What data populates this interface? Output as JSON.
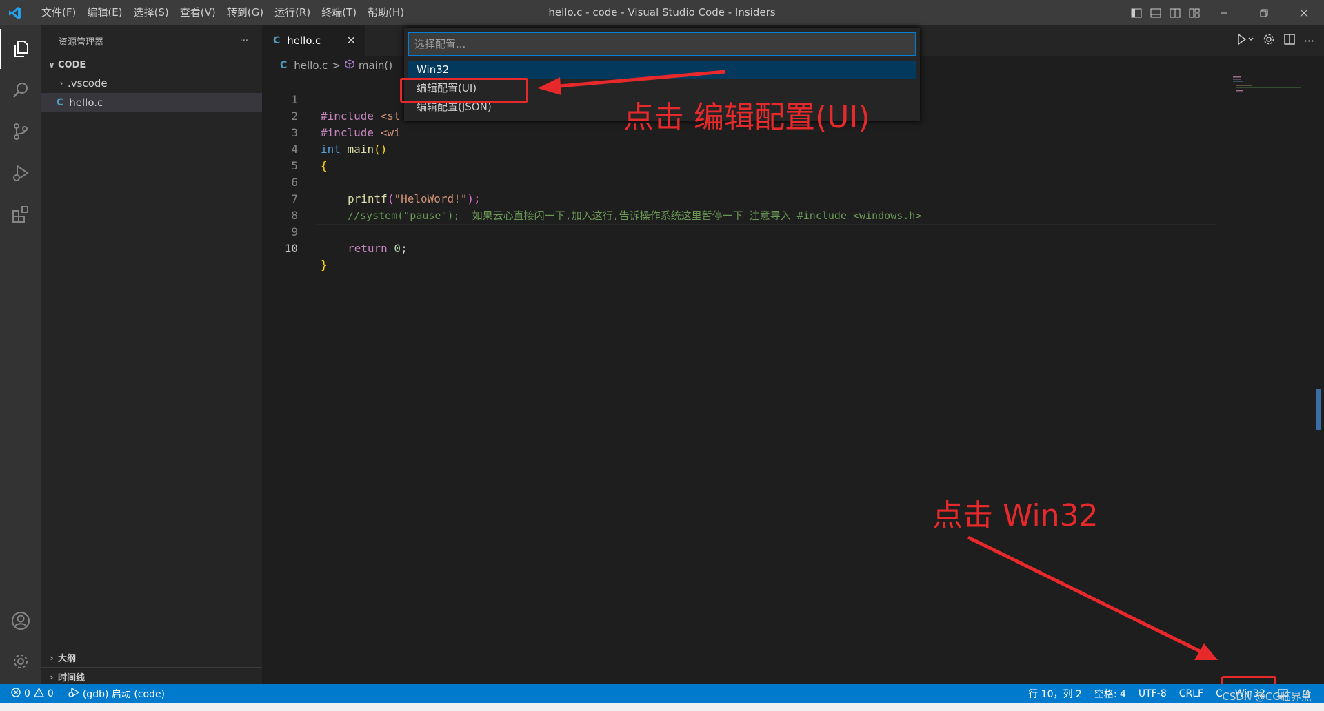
{
  "window": {
    "title": "hello.c - code - Visual Studio Code - Insiders",
    "menu": [
      "文件(F)",
      "编辑(E)",
      "选择(S)",
      "查看(V)",
      "转到(G)",
      "运行(R)",
      "终端(T)",
      "帮助(H)"
    ]
  },
  "sidebar": {
    "header": "资源管理器",
    "more": "···",
    "folder": "CODE",
    "items": [
      {
        "label": ".vscode",
        "type": "folder"
      },
      {
        "label": "hello.c",
        "type": "c-file"
      }
    ],
    "outline": "大纲",
    "timeline": "时间线"
  },
  "tab": {
    "icon": "C",
    "label": "hello.c",
    "close": "✕"
  },
  "breadcrumb": {
    "icon": "C",
    "file": "hello.c",
    "sep": ">",
    "symbol": "main()"
  },
  "editor": {
    "line_numbers": [
      "1",
      "2",
      "3",
      "4",
      "5",
      "6",
      "7",
      "8",
      "9",
      "10"
    ],
    "lines": [
      {
        "a": "#include",
        "b": " <st"
      },
      {
        "a": "#include",
        "b": " <wi"
      },
      {
        "a": "int",
        "b": " main",
        "c": "()"
      },
      {
        "a": "{"
      },
      {},
      {
        "a": "printf",
        "b": "(",
        "c": "\"HeloWord!\"",
        "d": ");"
      },
      {
        "a": "//system(\"pause\");  如果云心直接闪一下,加入这行,告诉操作系统这里暂停一下 注意导入 #include <windows.h>"
      },
      {},
      {
        "a": "return",
        "b": " 0",
        "c": ";"
      },
      {
        "a": "}"
      }
    ]
  },
  "quickpick": {
    "placeholder": "选择配置...",
    "items": [
      "Win32",
      "编辑配置(UI)",
      "编辑配置(JSON)"
    ]
  },
  "annotations": {
    "edit_ui": "点击 编辑配置(UI)",
    "win32": "点击 Win32"
  },
  "statusbar": {
    "errors": "0",
    "warnings": "0",
    "debug": "(gdb) 启动 (code)",
    "position": "行 10，列 2",
    "spaces": "空格: 4",
    "encoding": "UTF-8",
    "eol": "CRLF",
    "language": "C",
    "config": "Win32"
  },
  "watermark": "CSDN @CG临界点",
  "colors": {
    "statusbar": "#007acc",
    "annotation": "#e8292b",
    "selected_item": "#04395e"
  }
}
